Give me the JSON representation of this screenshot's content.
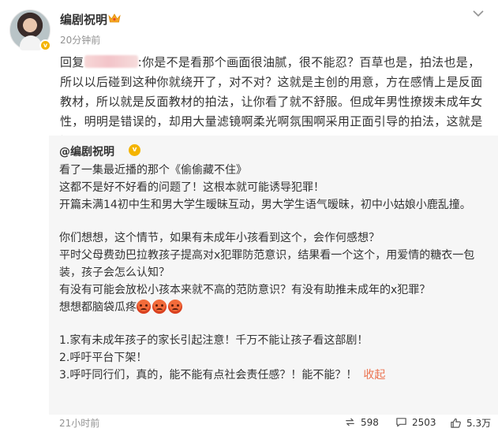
{
  "post": {
    "author": "编剧祝明",
    "time": "20分钟前",
    "reply_prefix": "回复",
    "reply_text": ":你是不是看那个画面很油腻，很不能忍？百草也是，拍法也是，所以以后碰到这种你就绕开了，对不对？这就是主创的用意，方在感情上是反面教材，所以就是反面教材的拍法，让你看了就不舒服。但成年男性撩拨未成年女性，明明是错误的，却用大量滤镜啊柔光啊氛围啊采用正面引导的拍法，这就是误导。",
    "more_icon": "more-horizontal-icon",
    "crown_icon": "crown-icon"
  },
  "quote": {
    "author": "@编剧祝明",
    "lines": [
      "看了一集最近播的那个《偷偷藏不住》",
      "这都不是好不好看的问题了！这根本就可能诱导犯罪！",
      "开篇未满14初中生和男大学生暧昧互动，男大学生语气暧昧，初中小姑娘小鹿乱撞。",
      "你们想想，这个情节，如果有未成年小孩看到这个，会作何感想？",
      "平时父母费劲巴拉教孩子提高对x犯罪防范意识，结果看一个这个，用爱情的糖衣一包装，孩子会怎么认知？",
      "有没有可能会放松小孩本来就不高的范防意识？有没有助推未成年的x犯罪？",
      "想想都脑袋瓜疼",
      "1.家有未成年孩子的家长引起注意！千万不能让孩子看这部剧！",
      "2.呼吁平台下架！",
      "3.呼吁同行们，真的，能不能有点社会责任感？！能不能？！"
    ],
    "collapse_label": "收起",
    "emoji_name": "angry-face-emoji",
    "time": "21小时前",
    "reposts": "598",
    "comments": "2503",
    "likes": "5.3万"
  },
  "colors": {
    "link": "#eb7350",
    "muted": "#939393",
    "quote_bg": "#f6f6f6",
    "verified": "#f4b400"
  }
}
